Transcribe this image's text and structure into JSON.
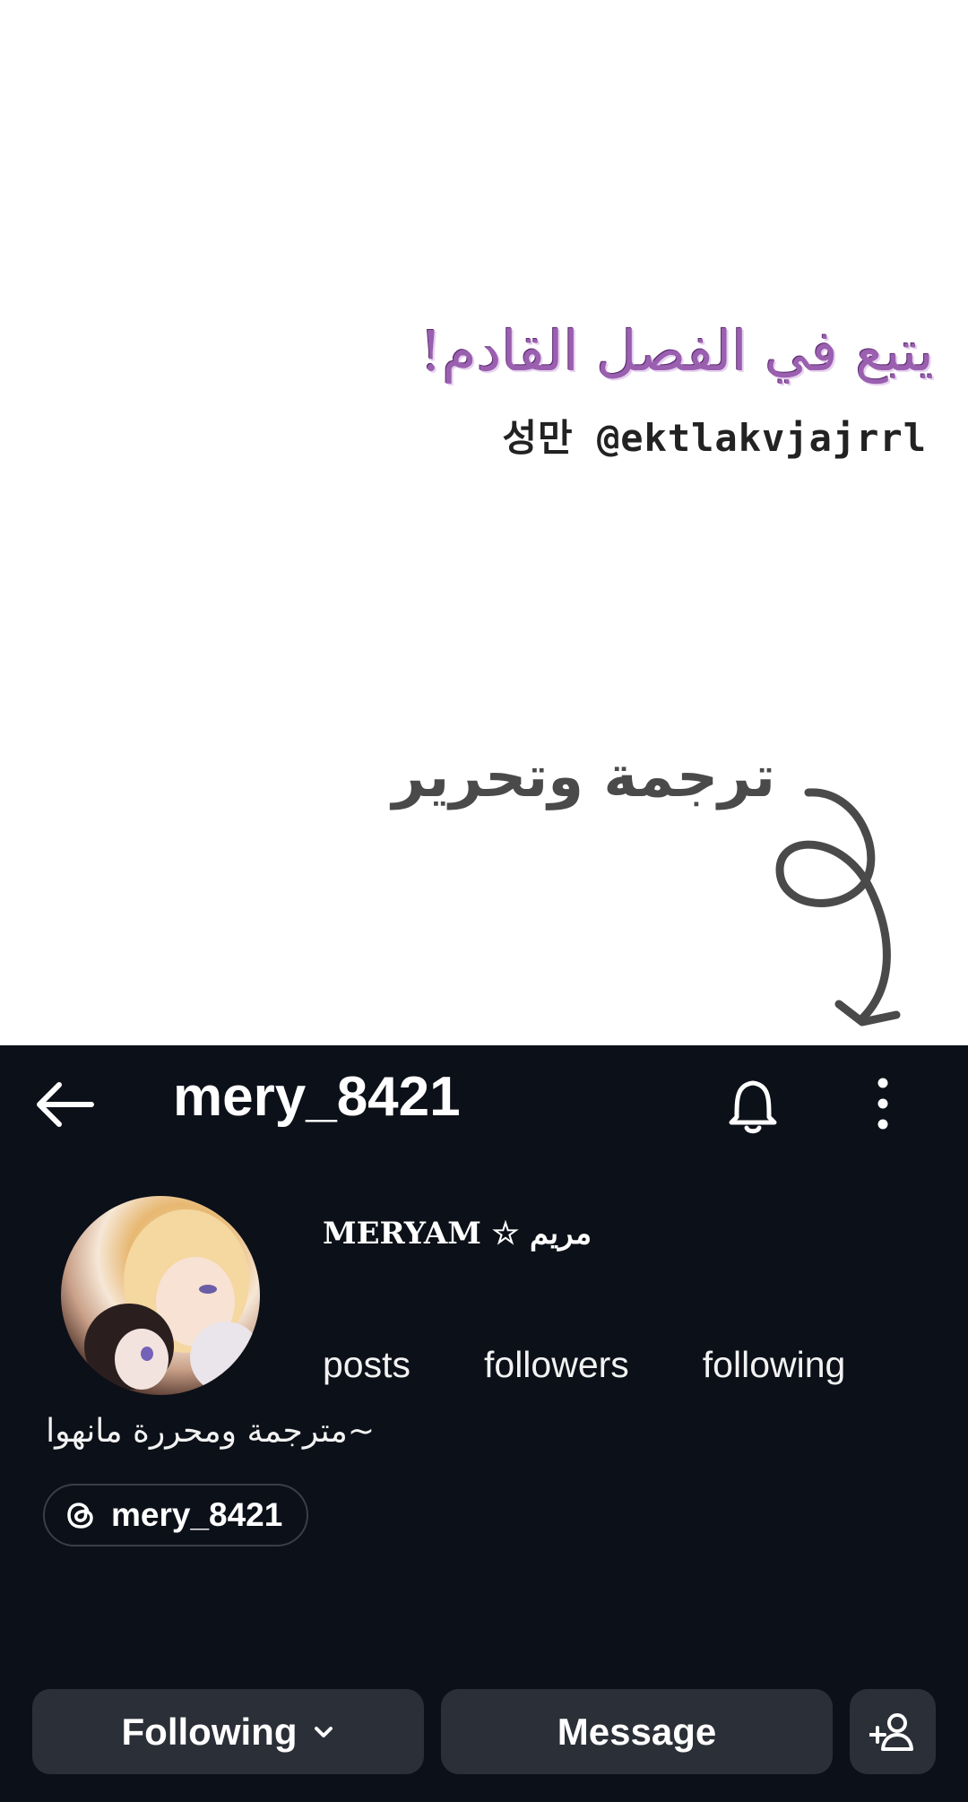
{
  "overlay": {
    "followup_text": "يتبع في الفصل القادم!",
    "credit_text": "성만 @ektlakvjajrrl",
    "translation_label": "ترجمة وتحرير"
  },
  "profile": {
    "username": "mery_8421",
    "display_name": "MERYAM ☆ مريم",
    "stats": {
      "posts_label": "posts",
      "followers_label": "followers",
      "following_label": "following"
    },
    "bio": "~مترجمة ومحررة مانهوا",
    "threads_handle": "mery_8421",
    "buttons": {
      "following_label": "Following",
      "message_label": "Message"
    }
  },
  "icons": [
    "back-arrow-icon",
    "bell-icon",
    "more-vertical-icon",
    "threads-icon",
    "chevron-down-icon",
    "add-person-icon"
  ],
  "colors": {
    "profile_bg": "#0c1018",
    "button_bg": "#2b2f37",
    "followup_purple": "#9b5fb0"
  }
}
